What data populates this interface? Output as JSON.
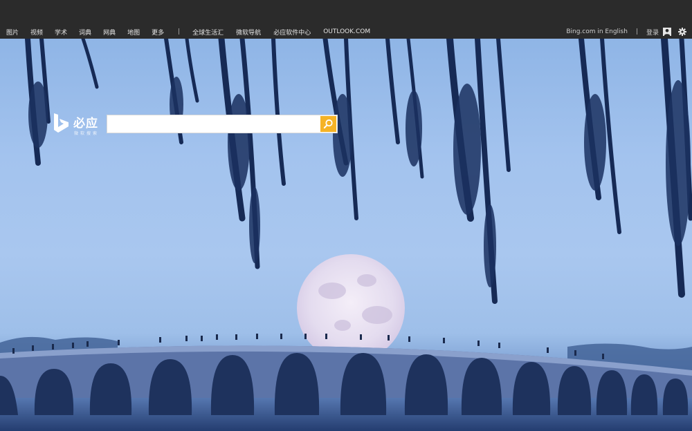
{
  "nav": {
    "left_items": [
      "图片",
      "视频",
      "学术",
      "词典",
      "网典",
      "地图",
      "更多"
    ],
    "separator": "|",
    "right_items": [
      "全球生活汇",
      "微软导航",
      "必应软件中心",
      "OUTLOOK.COM"
    ],
    "english_link": "Bing.com in English",
    "login": "登录"
  },
  "logo": {
    "title": "必应",
    "subtitle": "微软搜索"
  },
  "search": {
    "value": "",
    "placeholder": ""
  },
  "colors": {
    "topbar": "#2b2b2b",
    "search_button": "#f5b326"
  },
  "icons": {
    "search": "search-icon",
    "user": "user-icon",
    "settings": "gear-icon",
    "brand": "bing-logo-icon"
  }
}
